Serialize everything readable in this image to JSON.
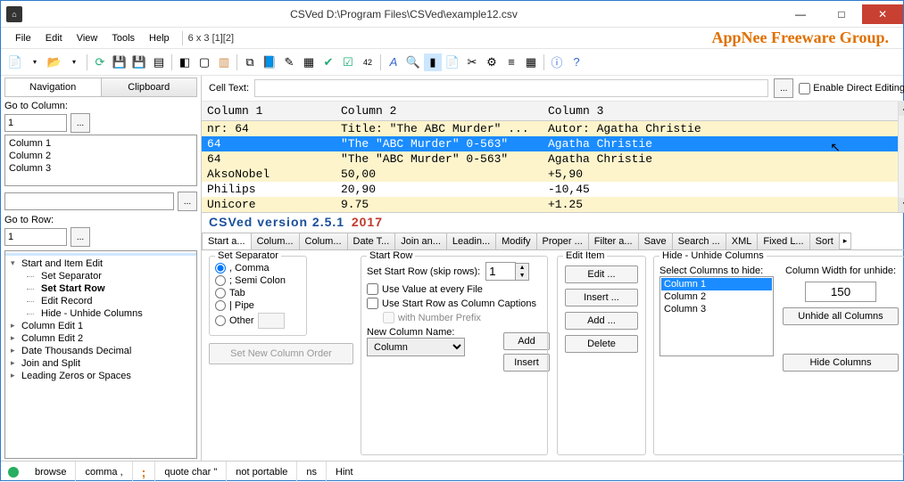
{
  "title": "CSVed D:\\Program Files\\CSVed\\example12.csv",
  "menus": {
    "file": "File",
    "edit": "Edit",
    "view": "View",
    "tools": "Tools",
    "help": "Help",
    "dims": "6 x 3 [1][2]"
  },
  "brand": "AppNee Freeware Group.",
  "celltext": {
    "label": "Cell Text:",
    "dots": "...",
    "enable": "Enable Direct Editing"
  },
  "nav": {
    "tab1": "Navigation",
    "tab2": "Clipboard",
    "gotocol": "Go to Column:",
    "gotorow": "Go to Row:",
    "dots": "...",
    "val": "1",
    "cols": [
      "Column 1",
      "Column 2",
      "Column 3"
    ]
  },
  "tree": {
    "n1": "Start and Item Edit",
    "n1a": "Set Separator",
    "n1b": "Set Start Row",
    "n1c": "Edit Record",
    "n1d": "Hide - Unhide Columns",
    "n2": "Column Edit 1",
    "n3": "Column Edit 2",
    "n4": "Date Thousands Decimal",
    "n5": "Join and Split",
    "n6": "Leading Zeros or Spaces"
  },
  "grid": {
    "h1": "Column 1",
    "h2": "Column 2",
    "h3": "Column 3",
    "rows": [
      {
        "c1": "nr: 64",
        "c2": "Title: \"The ABC Murder\" ...",
        "c3": "Autor: Agatha Christie"
      },
      {
        "c1": "64",
        "c2": "\"The \"ABC Murder\" 0-563\"",
        "c3": "Agatha Christie"
      },
      {
        "c1": "64",
        "c2": "\"The \"ABC Murder\" 0-563\"",
        "c3": "Agatha Christie"
      },
      {
        "c1": "AksoNobel",
        "c2": "50,00",
        "c3": "+5,90"
      },
      {
        "c1": "Philips",
        "c2": "20,90",
        "c3": "-10,45"
      },
      {
        "c1": "Unicore",
        "c2": "9.75",
        "c3": "+1.25"
      }
    ]
  },
  "ver": {
    "a": "CSVed version 2.5.1",
    "b": "2017"
  },
  "tabs": [
    "Start a...",
    "Colum...",
    "Colum...",
    "Date T...",
    "Join an...",
    "Leadin...",
    "Modify",
    "Proper ...",
    "Filter a...",
    "Save",
    "Search ...",
    "XML",
    "Fixed L...",
    "Sort"
  ],
  "sep": {
    "t": "Set Separator",
    "o1": ", Comma",
    "o2": "; Semi Colon",
    "o3": "Tab",
    "o4": "| Pipe",
    "o5": "Other"
  },
  "start": {
    "t": "Start Row",
    "l1": "Set Start Row (skip rows):",
    "v": "1",
    "c1": "Use Value at every File",
    "c2": "Use Start Row as Column Captions",
    "c3": "with Number Prefix",
    "l2": "New Column Name:",
    "col": "Column",
    "add": "Add",
    "ins": "Insert",
    "order": "Set New Column Order"
  },
  "edit": {
    "t": "Edit Item",
    "b1": "Edit ...",
    "b2": "Insert ...",
    "b3": "Add ...",
    "b4": "Delete"
  },
  "hide": {
    "t": "Hide - Unhide Columns",
    "sel": "Select Columns to hide:",
    "cw": "Column Width for unhide:",
    "cwv": "150",
    "b1": "Unhide all Columns",
    "b2": "Hide Columns",
    "i1": "Column 1",
    "i2": "Column 2",
    "i3": "Column 3"
  },
  "status": {
    "browse": "browse",
    "comma": "comma ,",
    "semi": ";",
    "quote": "quote char \"",
    "port": "not portable",
    "ns": "ns",
    "hint": "Hint"
  }
}
